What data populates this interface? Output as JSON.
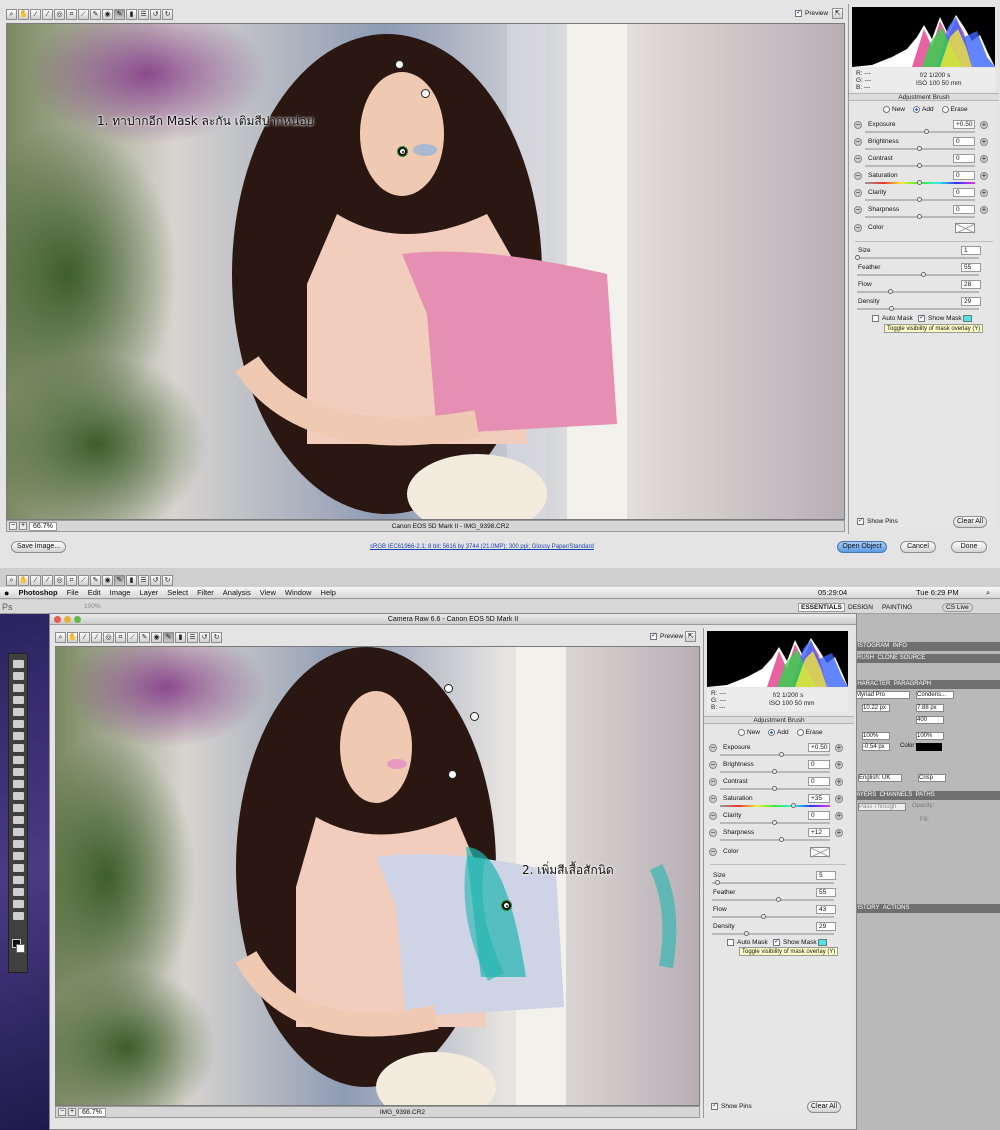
{
  "top": {
    "preview_label": "Preview",
    "annotation": "1. ทาปากอีก Mask ละกัน เติมสีปากหน่อย",
    "status_zoom": "66.7%",
    "status_title": "Canon EOS 5D Mark II  -  IMG_9398.CR2",
    "histogram": {
      "r": "R:  ---",
      "g": "G:  ---",
      "b": "B:  ---",
      "aperture_shutter": "f/2    1/200 s",
      "iso_lens": "ISO 100    50 mm"
    },
    "panel_title": "Adjustment Brush",
    "modes": [
      "New",
      "Add",
      "Erase"
    ],
    "mode_selected": "Add",
    "adjustments": [
      {
        "label": "Exposure",
        "value": "+0.50",
        "level": 0.56
      },
      {
        "label": "Brightness",
        "value": "0",
        "level": 0.5
      },
      {
        "label": "Contrast",
        "value": "0",
        "level": 0.5
      },
      {
        "label": "Saturation",
        "value": "0",
        "level": 0.5
      },
      {
        "label": "Clarity",
        "value": "0",
        "level": 0.5
      },
      {
        "label": "Sharpness",
        "value": "0",
        "level": 0.5
      }
    ],
    "color_label": "Color",
    "brush": [
      {
        "label": "Size",
        "value": "1",
        "level": 0.01
      },
      {
        "label": "Feather",
        "value": "55",
        "level": 0.55
      },
      {
        "label": "Flow",
        "value": "28",
        "level": 0.28
      },
      {
        "label": "Density",
        "value": "29",
        "level": 0.29
      }
    ],
    "auto_mask": "Auto Mask",
    "show_mask": "Show Mask",
    "tooltip": "Toggle visibility of mask overlay (Y)",
    "show_pins": "Show Pins",
    "clear_all": "Clear All",
    "save_image": "Save Image...",
    "workflow_link": "sRGB IEC61966-2.1; 8 bit; 5616 by 3744 (21.0MP); 300 ppi; Glossy Paper/Standard",
    "open_object": "Open Object",
    "cancel": "Cancel",
    "done": "Done"
  },
  "bottom": {
    "mac_menu": [
      "Photoshop",
      "File",
      "Edit",
      "Image",
      "Layer",
      "Select",
      "Filter",
      "Analysis",
      "View",
      "Window",
      "Help"
    ],
    "clock": "05:29:04",
    "datetime": "Tue 6:29 PM",
    "ps_percent": "100%",
    "workspaces": [
      "ESSENTIALS",
      "DESIGN",
      "PAINTING"
    ],
    "cs_live": "CS Live",
    "window_title": "Camera Raw 6.6  -  Canon EOS 5D Mark II",
    "preview_label": "Preview",
    "annotation": "2. เพิ่มสีเสื้อสักนิด",
    "status_zoom": "66.7%",
    "status_title": "IMG_9398.CR2",
    "histogram": {
      "r": "R:  ---",
      "g": "G:  ---",
      "b": "B:  ---",
      "aperture_shutter": "f/2    1/200 s",
      "iso_lens": "ISO 100    50 mm"
    },
    "panel_title": "Adjustment Brush",
    "modes": [
      "New",
      "Add",
      "Erase"
    ],
    "mode_selected": "Add",
    "adjustments": [
      {
        "label": "Exposure",
        "value": "+0.50",
        "level": 0.56
      },
      {
        "label": "Brightness",
        "value": "0",
        "level": 0.5
      },
      {
        "label": "Contrast",
        "value": "0",
        "level": 0.5
      },
      {
        "label": "Saturation",
        "value": "+35",
        "level": 0.67
      },
      {
        "label": "Clarity",
        "value": "0",
        "level": 0.5
      },
      {
        "label": "Sharpness",
        "value": "+12",
        "level": 0.56
      }
    ],
    "color_label": "Color",
    "brush": [
      {
        "label": "Size",
        "value": "5",
        "level": 0.05
      },
      {
        "label": "Feather",
        "value": "55",
        "level": 0.55
      },
      {
        "label": "Flow",
        "value": "43",
        "level": 0.43
      },
      {
        "label": "Density",
        "value": "29",
        "level": 0.29
      }
    ],
    "auto_mask": "Auto Mask",
    "show_mask": "Show Mask",
    "tooltip": "Toggle visibility of mask overlay (Y)",
    "show_pins": "Show Pins",
    "clear_all": "Clear All",
    "ps_panel_tabs": [
      "HISTOGRAM",
      "INFO"
    ],
    "ps_panel_tabs2": [
      "BRUSH",
      "CLONE SOURCE"
    ],
    "ps_panel_tabs3": [
      "CHARACTER",
      "PARAGRAPH"
    ],
    "char_font": "Myriad Pro",
    "char_style": "Condens...",
    "char_size": "10.22 px",
    "char_leading": "7.88 px",
    "char_tracking": "400",
    "char_scale_v": "100%",
    "char_scale_h": "100%",
    "char_baseline": "-0.54 px",
    "char_color": "Color:",
    "char_lang": "English: UK",
    "char_aa": "Crisp",
    "ps_panel_tabs4": [
      "LAYERS",
      "CHANNELS",
      "PATHS"
    ],
    "blend": "Pass Through",
    "opacity": "Opacity:",
    "fill": "Fill:",
    "ps_panel_tabs5": [
      "HISTORY",
      "ACTIONS"
    ]
  }
}
